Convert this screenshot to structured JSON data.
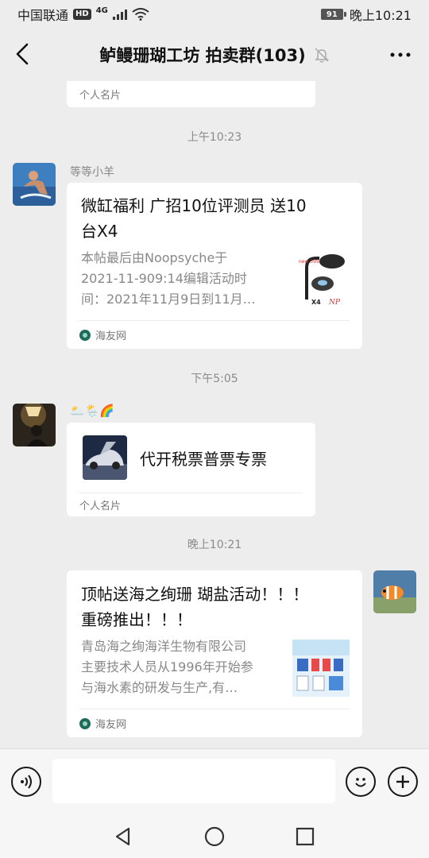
{
  "status_bar": {
    "carrier": "中国联通",
    "hd": "HD",
    "network": "4G",
    "battery": "91",
    "time": "晚上10:21"
  },
  "header": {
    "title": "鲈鳗珊瑚工坊 拍卖群(103)",
    "back_icon": "back-chevron-icon",
    "mute_icon": "bell-muted-icon",
    "more_icon": "more-dots-icon"
  },
  "messages": {
    "partial_card": {
      "footer": "个人名片"
    },
    "time_1": "上午10:23",
    "msg_1": {
      "sender": "等等小羊",
      "title": "微缸福利  广招10位评测员  送10台X4",
      "title_line1": "微缸福利  广招10位评测员  送10",
      "title_line2": "台X4",
      "desc_line1": "本帖最后由Noopsyche于",
      "desc_line2": "2021-11-909:14编辑活动时",
      "desc_line3": "间：2021年11月9日到11月…",
      "source": "海友网"
    },
    "time_2": "下午5:05",
    "msg_2": {
      "sender": "🌥️🌦️🌈",
      "card_name": "代开税票普票专票",
      "footer": "个人名片"
    },
    "time_3": "晚上10:21",
    "msg_3": {
      "title_line1": "顶帖送海之绚珊 瑚盐活动！！！",
      "title_line2": "重磅推出！！！",
      "desc_line1": "青岛海之绚海洋生物有限公司",
      "desc_line2": "主要技术人员从1996年开始参",
      "desc_line3": "与海水素的研发与生产,有…",
      "source": "海友网"
    }
  },
  "input_bar": {
    "placeholder": "",
    "voice_icon": "voice-icon",
    "emoji_icon": "emoji-icon",
    "plus_icon": "plus-icon"
  },
  "nav_bar": {
    "back_icon": "nav-back-icon",
    "home_icon": "nav-home-icon",
    "recents_icon": "nav-recents-icon"
  },
  "colors": {
    "background": "#ededed",
    "card": "#ffffff",
    "source_icon": "#1f6b5a"
  }
}
